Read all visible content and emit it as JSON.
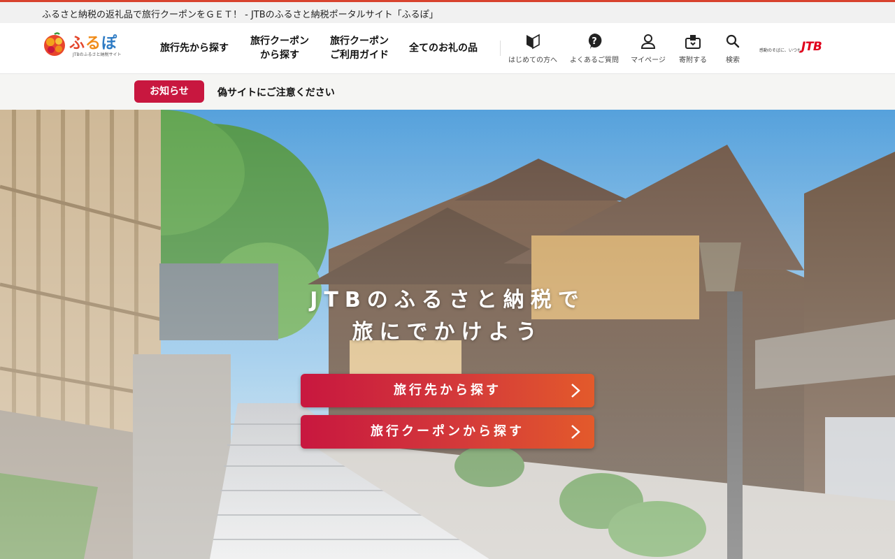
{
  "tagline": "ふるさと納税の返礼品で旅行クーポンをＧＥＴ！ - JTBのふるさと納税ポータルサイト「ふるぽ」",
  "logo": {
    "name_1": "ふ",
    "name_2": "る",
    "name_3": "ぽ",
    "subtitle": "JTBのふるさと納税サイト"
  },
  "nav": {
    "destination": "旅行先から探す",
    "coupon_line1": "旅行クーポン",
    "coupon_line2": "から探す",
    "guide_line1": "旅行クーポン",
    "guide_line2": "ご利用ガイド",
    "all_gifts": "全てのお礼の品"
  },
  "utility": {
    "beginners": "はじめての方へ",
    "faq": "よくあるご質問",
    "mypage": "マイページ",
    "donate": "寄附する",
    "search": "検索"
  },
  "jtb": {
    "slogan": "感動のそばに、いつも。",
    "logo": "JTB"
  },
  "notice": {
    "badge": "お知らせ",
    "text": "偽サイトにご注意ください"
  },
  "hero": {
    "title_line1": "JTBのふるさと納税で",
    "title_line2": "旅にでかけよう",
    "cta_destination": "旅行先から探す",
    "cta_coupon": "旅行クーポンから探す"
  },
  "colors": {
    "brand_red": "#c8173f",
    "accent_orange": "#e35a2b",
    "jtb_red": "#e0001b",
    "top_line": "#d8432e"
  },
  "icons": [
    "beginner-mark-icon",
    "question-bubble-icon",
    "person-icon",
    "donation-box-icon",
    "search-icon",
    "chevron-right-icon"
  ]
}
